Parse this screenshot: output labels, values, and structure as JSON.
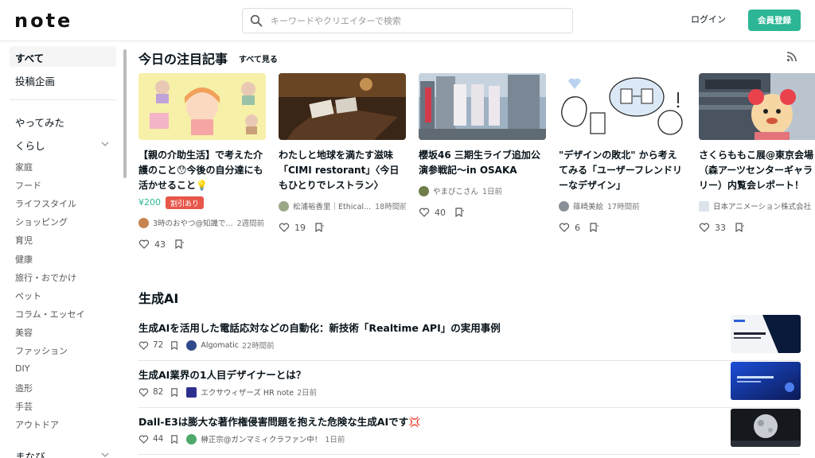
{
  "header": {
    "logo": "note",
    "search_placeholder": "キーワードやクリエイターで検索",
    "login": "ログイン",
    "register": "会員登録"
  },
  "sidebar": {
    "top": [
      "すべて",
      "投稿企画"
    ],
    "groups": [
      "やってみた",
      "くらし"
    ],
    "subitems": [
      "家庭",
      "フード",
      "ライフスタイル",
      "ショッピング",
      "育児",
      "健康",
      "旅行・おでかけ",
      "ペット",
      "コラム・エッセイ",
      "美容",
      "ファッション",
      "DIY",
      "造形",
      "手芸",
      "アウトドア"
    ],
    "bottom_group": "まなび"
  },
  "featured": {
    "title": "今日の注目記事",
    "see_all": "すべて見る",
    "cards": [
      {
        "title": "【親の介助生活】で考えた介護のこと😯今後の自分達にも活かせること💡",
        "price": "¥200",
        "badge": "割引あり",
        "author": "3時のおやつ@知識で...",
        "time": "2週間前",
        "likes": "43"
      },
      {
        "title": "わたしと地球を満たす滋味「CIMI restorant」〈今日もひとりでレストラン〉",
        "author": "松浦裕香里｜Ethical...",
        "time": "18時間前",
        "likes": "19"
      },
      {
        "title": "櫻坂46 三期生ライブ追加公演参戦記〜in OSAKA",
        "author": "やまびこさん",
        "time": "1日前",
        "likes": "40"
      },
      {
        "title": "\"デザインの敗北\" から考えてみる「ユーザーフレンドリーなデザイン」",
        "author": "篠崎美絵",
        "time": "17時間前",
        "likes": "6"
      },
      {
        "title": "さくらももこ展@東京会場（森アーツセンターギャラリー）内覧会レポート！",
        "author": "日本アニメーション株式会社",
        "time": "",
        "likes": "33"
      }
    ]
  },
  "ai_section": {
    "title": "生成AI",
    "rows": [
      {
        "title": "生成AIを活用した電話応対などの自動化：新技術「Realtime API」の実用事例",
        "likes": "72",
        "author": "Algomatic",
        "time": "22時間前"
      },
      {
        "title": "生成AI業界の1人目デザイナーとは？",
        "likes": "82",
        "author": "エクサウィザーズ HR note",
        "time": "2日前"
      },
      {
        "title": "Dall-E3は膨大な著作権侵害問題を抱えた危険な生成AIです💢",
        "likes": "44",
        "author": "榊正宗@ガンマミィクラファン中！",
        "time": "1日前"
      }
    ]
  }
}
